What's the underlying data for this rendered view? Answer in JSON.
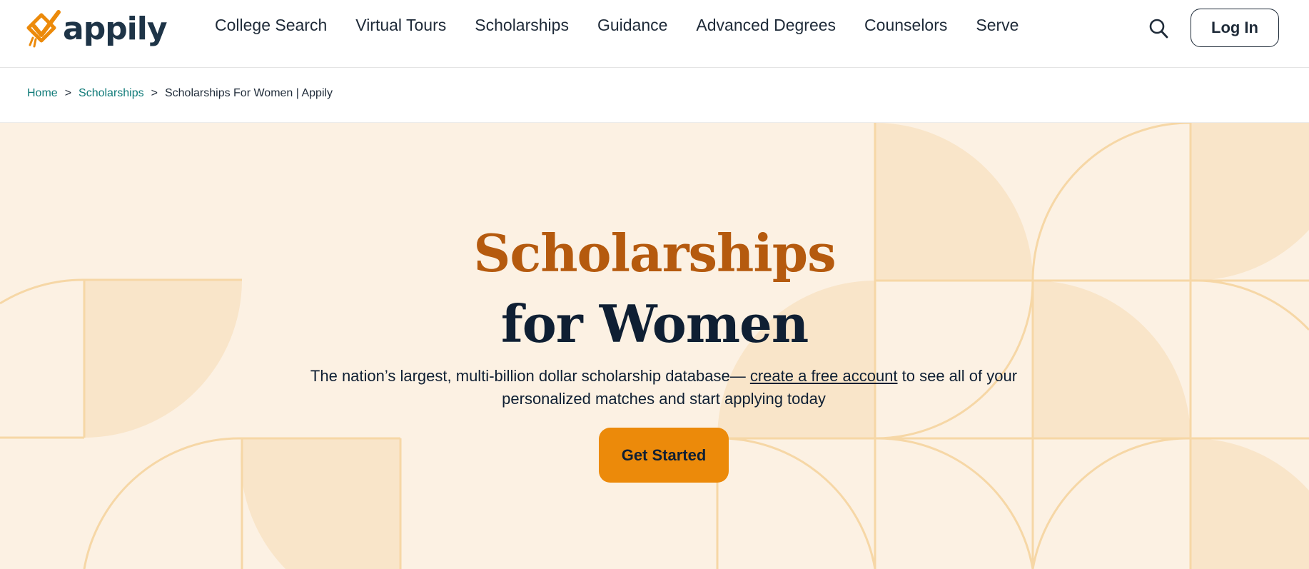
{
  "brand": {
    "name": "appily",
    "accent_color": "#ec8a0a",
    "logo_icon": "checkmark-diamond-icon"
  },
  "nav": {
    "links": [
      "College Search",
      "Virtual Tours",
      "Scholarships",
      "Guidance",
      "Advanced Degrees",
      "Counselors",
      "Serve"
    ],
    "search_icon": "search-icon",
    "login_label": "Log In"
  },
  "breadcrumb": {
    "home": "Home",
    "separator": ">",
    "scholarships": "Scholarships",
    "current": "Scholarships For Women | Appily"
  },
  "hero": {
    "title_line1": "Scholarships",
    "title_line2": "for Women",
    "title_line1_color": "#b55a0e",
    "description_before": "The nation’s largest, multi-billion dollar scholarship database— ",
    "description_link": "create a free account",
    "description_after": " to see all of your personalized matches and start applying today",
    "cta_label": "Get Started",
    "background_color": "#fcf1e3"
  }
}
